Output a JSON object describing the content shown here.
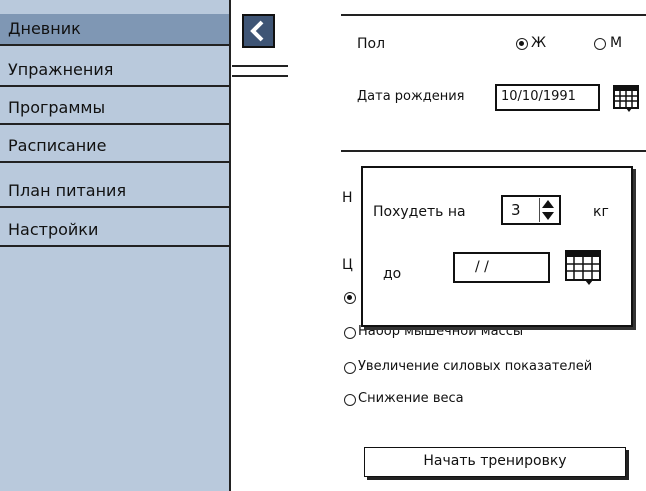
{
  "sidebar": {
    "items": [
      {
        "label": "Дневник",
        "active": true
      },
      {
        "label": "Упражнения"
      },
      {
        "label": "Программы"
      },
      {
        "label": "Расписание"
      },
      {
        "label": "План питания"
      },
      {
        "label": "Настройки"
      }
    ]
  },
  "form": {
    "gender_label": "Пол",
    "gender_options": [
      {
        "label": "Ж",
        "selected": true
      },
      {
        "label": "М",
        "selected": false
      }
    ],
    "birthdate_label": "Дата рождения",
    "birthdate_value": "10/10/1991",
    "partial_label_1": "Н",
    "partial_label_2": "Ц",
    "goals": [
      {
        "label": "",
        "selected": true
      },
      {
        "label": "Набор мышечной массы",
        "selected": false
      },
      {
        "label": "Увеличение силовых показателей",
        "selected": false
      },
      {
        "label": "Снижение веса",
        "selected": false
      }
    ],
    "start_button_label": "Начать тренировку"
  },
  "popup": {
    "lose_label": "Похудеть на",
    "amount_value": "3",
    "unit_label": "кг",
    "until_label": "до",
    "date_value": "/ /"
  },
  "colors": {
    "sidebar_bg": "#b9c9dc",
    "sidebar_active": "#7f97b4",
    "back_button": "#3f5575"
  },
  "icons": {
    "back": "chevron-left-icon",
    "calendar": "calendar-icon",
    "stepper": "stepper-arrows-icon"
  }
}
